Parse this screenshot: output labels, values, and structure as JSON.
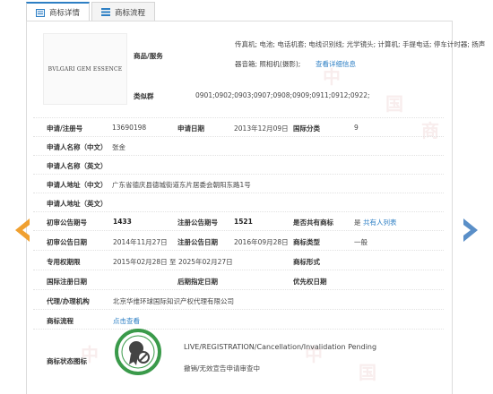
{
  "tabs": [
    {
      "label": "商标详情"
    },
    {
      "label": "商标流程"
    }
  ],
  "logo": {
    "text": "BVLGARI GEM ESSENCE"
  },
  "goods": {
    "label": "商品/服务",
    "line1": "传真机; 电池; 电话机套; 电线识别线; 光学镜头; 计算机; 手提电话; 停车计时器; 扬声",
    "line2": "器音箱; 照相机(摄影);",
    "link": "查看详细信息"
  },
  "classes": {
    "label": "类似群",
    "value": "0901;0902;0903;0907;0908;0909;0911;0912;0922;"
  },
  "fields": {
    "reg_no_label": "申请/注册号",
    "reg_no": "13690198",
    "apply_date_label": "申请日期",
    "apply_date": "2013年12月09日",
    "intl_class_label": "国际分类",
    "intl_class": "9",
    "applicant_cn_label": "申请人名称（中文）",
    "applicant_cn": "张金",
    "applicant_en_label": "申请人名称（英文）",
    "address_cn_label": "申请人地址（中文）",
    "address_cn": "广东省德庆县德城街道东片居委会朝阳东路1号",
    "address_en_label": "申请人地址（英文）",
    "prelim_no_label": "初审公告期号",
    "prelim_no": "1433",
    "reg_pub_no_label": "注册公告期号",
    "reg_pub_no": "1521",
    "shared_label": "是否共有商标",
    "shared": "是",
    "shared_link": "共有人列表",
    "prelim_date_label": "初审公告日期",
    "prelim_date": "2014年11月27日",
    "reg_pub_date_label": "注册公告日期",
    "reg_pub_date": "2016年09月28日",
    "tm_type_label": "商标类型",
    "tm_type": "一般",
    "exclusive_label": "专用权期限",
    "exclusive": "2015年02月28日 至 2025年02月27日",
    "tm_form_label": "商标形式",
    "intl_reg_date_label": "国际注册日期",
    "later_date_label": "后期指定日期",
    "priority_label": "优先权日期",
    "agent_label": "代理/办理机构",
    "agent": "北京华维环球国际知识产权代理有限公司",
    "process_label": "商标流程",
    "process_link": "点击查看",
    "status_label": "商标状态图标",
    "status_en": "LIVE/REGISTRATION/Cancellation/Invalidation Pending",
    "status_cn": "撤销/无效宣告申请审查中"
  },
  "watermark": "中国商标网",
  "colors": {
    "accent": "#2d7fc4",
    "arrow": "#f0a030",
    "arrow_right": "#5a8fc8",
    "badge_green": "#3a9a4a"
  }
}
